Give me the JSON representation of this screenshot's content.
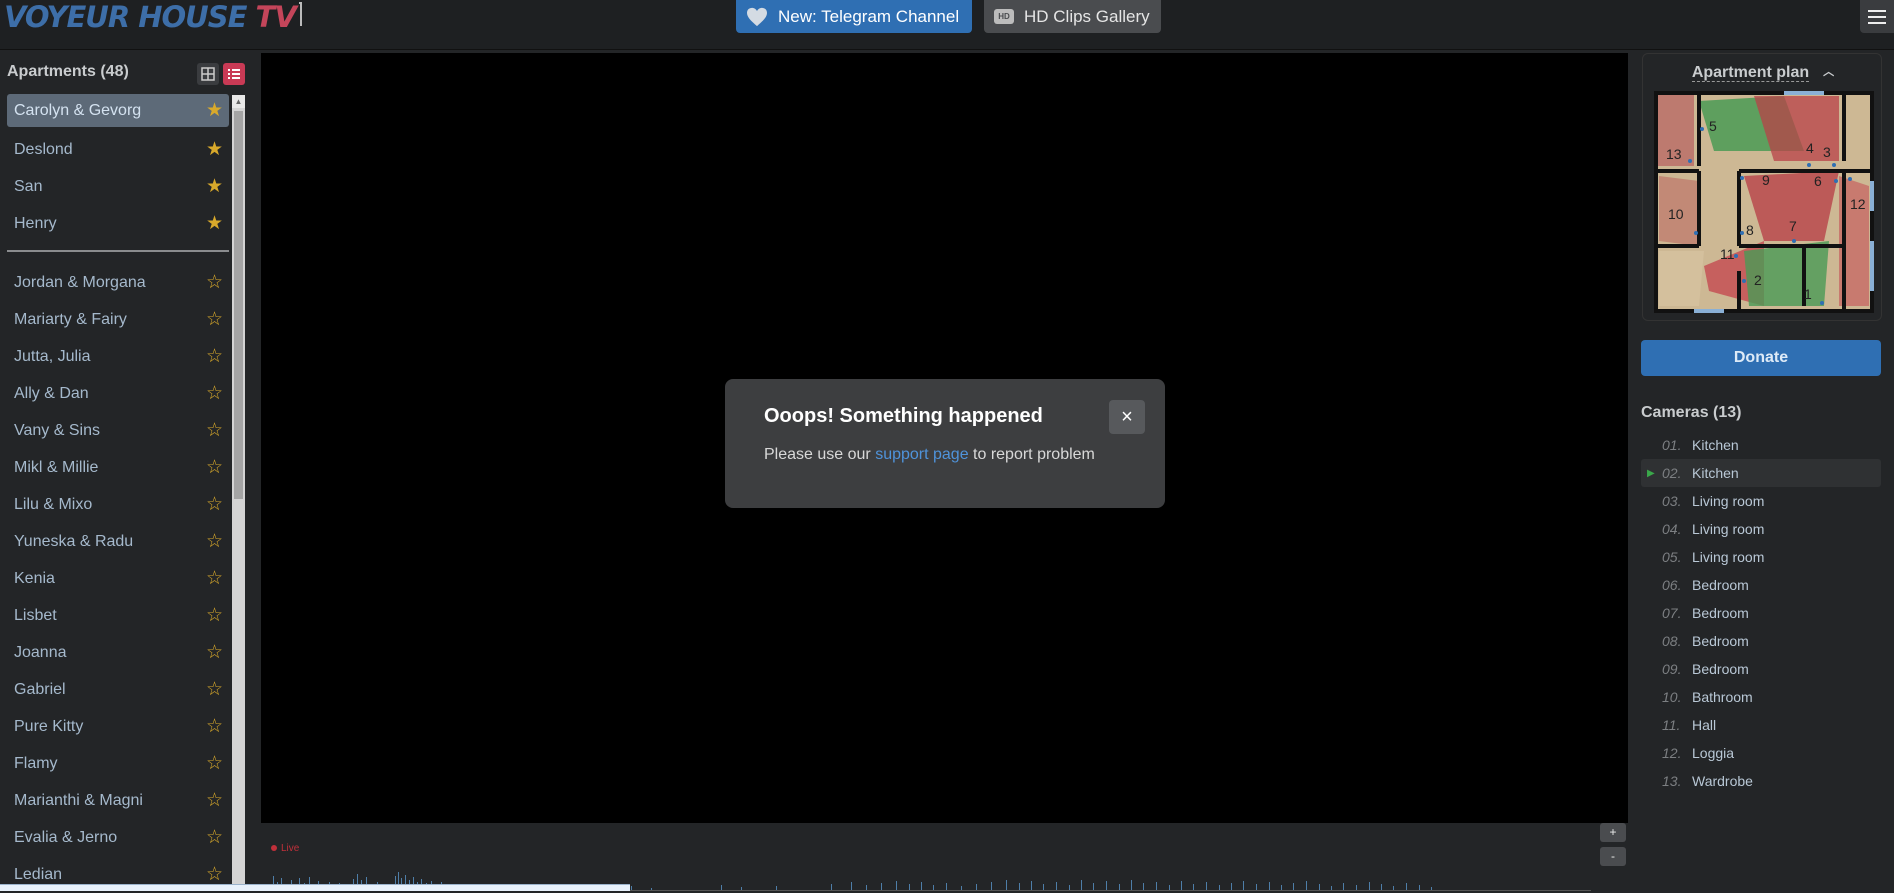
{
  "header": {
    "logo_main": "VOYEUR HOUSE",
    "logo_tv": "TV",
    "telegram_label": "New: Telegram Channel",
    "hd_badge": "HD",
    "hd_label": "HD Clips Gallery"
  },
  "sidebar": {
    "title": "Apartments (48)",
    "favorites": [
      {
        "label": "Carolyn & Gevorg"
      },
      {
        "label": "Deslond"
      },
      {
        "label": "San"
      },
      {
        "label": "Henry"
      }
    ],
    "items": [
      {
        "label": "Jordan & Morgana"
      },
      {
        "label": "Mariarty & Fairy"
      },
      {
        "label": "Jutta, Julia"
      },
      {
        "label": "Ally & Dan"
      },
      {
        "label": "Vany & Sins"
      },
      {
        "label": "Mikl & Millie"
      },
      {
        "label": "Lilu & Mixo"
      },
      {
        "label": "Yuneska & Radu"
      },
      {
        "label": "Kenia"
      },
      {
        "label": "Lisbet"
      },
      {
        "label": "Joanna"
      },
      {
        "label": "Gabriel"
      },
      {
        "label": "Pure Kitty"
      },
      {
        "label": "Flamy"
      },
      {
        "label": "Marianthi & Magni"
      },
      {
        "label": "Evalia & Jerno"
      },
      {
        "label": "Ledian"
      }
    ],
    "star_filled": "★",
    "star_empty": "☆"
  },
  "modal": {
    "title": "Ooops! Something happened",
    "close": "×",
    "text_before": "Please use our ",
    "link": "support page",
    "text_after": " to report problem"
  },
  "timeline": {
    "live": "Live",
    "zoom_in": "+",
    "zoom_out": "-"
  },
  "plan": {
    "title": "Apartment plan",
    "room_numbers": [
      "5",
      "13",
      "4",
      "3",
      "9",
      "6",
      "12",
      "10",
      "8",
      "7",
      "11",
      "2",
      "1"
    ]
  },
  "donate": "Donate",
  "cameras": {
    "title": "Cameras (13)",
    "active_index": 1,
    "items": [
      {
        "num": "01.",
        "name": "Kitchen"
      },
      {
        "num": "02.",
        "name": "Kitchen"
      },
      {
        "num": "03.",
        "name": "Living room"
      },
      {
        "num": "04.",
        "name": "Living room"
      },
      {
        "num": "05.",
        "name": "Living room"
      },
      {
        "num": "06.",
        "name": "Bedroom"
      },
      {
        "num": "07.",
        "name": "Bedroom"
      },
      {
        "num": "08.",
        "name": "Bedroom"
      },
      {
        "num": "09.",
        "name": "Bedroom"
      },
      {
        "num": "10.",
        "name": "Bathroom"
      },
      {
        "num": "11.",
        "name": "Hall"
      },
      {
        "num": "12.",
        "name": "Loggia"
      },
      {
        "num": "13.",
        "name": "Wardrobe"
      }
    ]
  },
  "colors": {
    "accent_blue": "#2f6fb3",
    "accent_red": "#c93a55",
    "star": "#d8a92b",
    "link": "#4f93da"
  }
}
